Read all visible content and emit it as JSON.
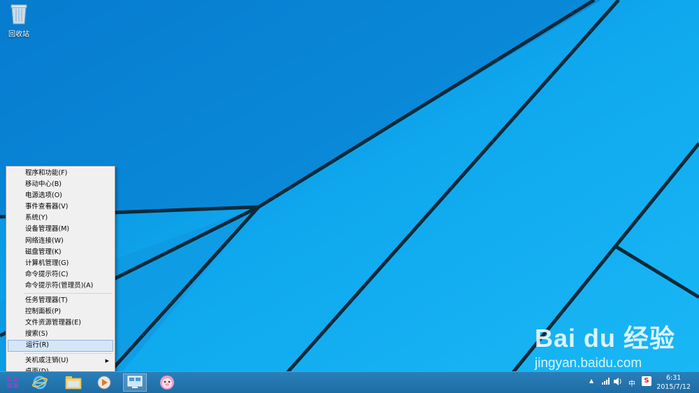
{
  "desktop": {
    "recycle_bin_label": "回收站"
  },
  "context_menu": {
    "group1": [
      "程序和功能(F)",
      "移动中心(B)",
      "电源选项(O)",
      "事件查看器(V)",
      "系统(Y)",
      "设备管理器(M)",
      "网络连接(W)",
      "磁盘管理(K)",
      "计算机管理(G)",
      "命令提示符(C)",
      "命令提示符(管理员)(A)"
    ],
    "group2": [
      "任务管理器(T)",
      "控制面板(P)",
      "文件资源管理器(E)",
      "搜索(S)",
      "运行(R)"
    ],
    "group3": [
      "关机或注销(U)",
      "桌面(D)"
    ],
    "selected_item": "运行(R)"
  },
  "taskbar": {
    "apps": [
      "internet-explorer-icon",
      "file-explorer-icon",
      "media-player-icon",
      "remote-desktop-icon",
      "pig-app-icon"
    ],
    "tray": {
      "ime": "中",
      "sogou": "S",
      "time": "6:31",
      "date": "2015/7/12"
    }
  },
  "watermark": {
    "logo": "Bai du 经验",
    "url": "jingyan.baidu.com"
  },
  "colors": {
    "wallpaper": "#0aa0e8",
    "taskbar": "#1e6ca5",
    "menu_bg": "#f0f0f0",
    "menu_selected": "#d5e6f7"
  }
}
